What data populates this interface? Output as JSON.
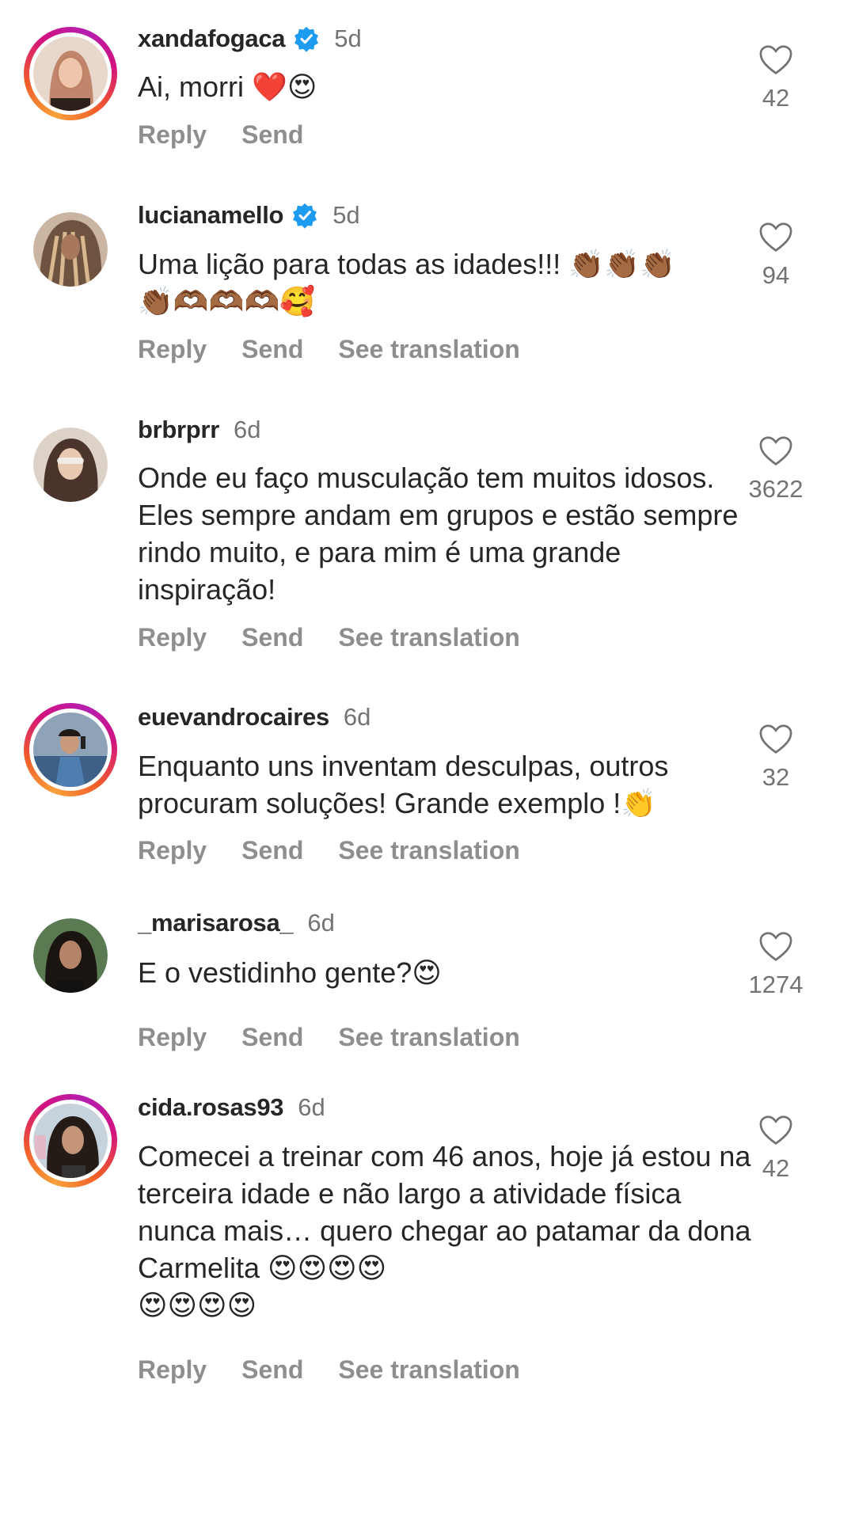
{
  "action_labels": {
    "reply": "Reply",
    "send": "Send",
    "see_translation": "See translation"
  },
  "comments": [
    {
      "username": "xandafogaca",
      "verified": true,
      "age": "5d",
      "text": "Ai, morri ❤️😍",
      "likes": "42",
      "avatar_ring": true,
      "avatar_colors": [
        "#d9b7a3",
        "#7a4b3a"
      ]
    },
    {
      "username": "lucianamello",
      "verified": true,
      "age": "5d",
      "text": "Uma lição para todas as idades!!! 👏🏾👏🏾👏🏾\n👏🏾🫶🏾🫶🏾🫶🏾🥰",
      "likes": "94",
      "avatar_ring": false,
      "avatar_colors": [
        "#a28a73",
        "#4d3a2c"
      ]
    },
    {
      "username": "brbrprr",
      "verified": false,
      "age": "6d",
      "text": "Onde eu faço musculação tem muitos idosos. Eles sempre andam em grupos e estão sempre rindo muito, e para mim é uma grande inspiração!",
      "likes": "3622",
      "avatar_ring": false,
      "avatar_colors": [
        "#d8c2b3",
        "#3d2a23"
      ]
    },
    {
      "username": "euevandrocaires",
      "verified": false,
      "age": "6d",
      "text": "Enquanto uns inventam desculpas,  outros procuram soluções! Grande exemplo !👏",
      "likes": "32",
      "avatar_ring": true,
      "avatar_colors": [
        "#6b8fb0",
        "#2b3b52"
      ]
    },
    {
      "username": "_marisarosa_",
      "verified": false,
      "age": "6d",
      "text": "E o vestidinho gente?😍",
      "likes": "1274",
      "avatar_ring": false,
      "avatar_colors": [
        "#4f6b4a",
        "#1e1a17"
      ]
    },
    {
      "username": "cida.rosas93",
      "verified": false,
      "age": "6d",
      "text": "Comecei a treinar com 46 anos, hoje já estou na terceira idade e não largo a atividade física nunca mais… quero chegar ao patamar da dona Carmelita 😍😍😍😍\n😍😍😍😍",
      "likes": "42",
      "avatar_ring": true,
      "avatar_colors": [
        "#9fb6c9",
        "#2a201c"
      ]
    }
  ],
  "colors": {
    "text": "#262626",
    "secondary": "#737373",
    "action": "#8e8e8e",
    "verified": "#1d9bf0"
  }
}
